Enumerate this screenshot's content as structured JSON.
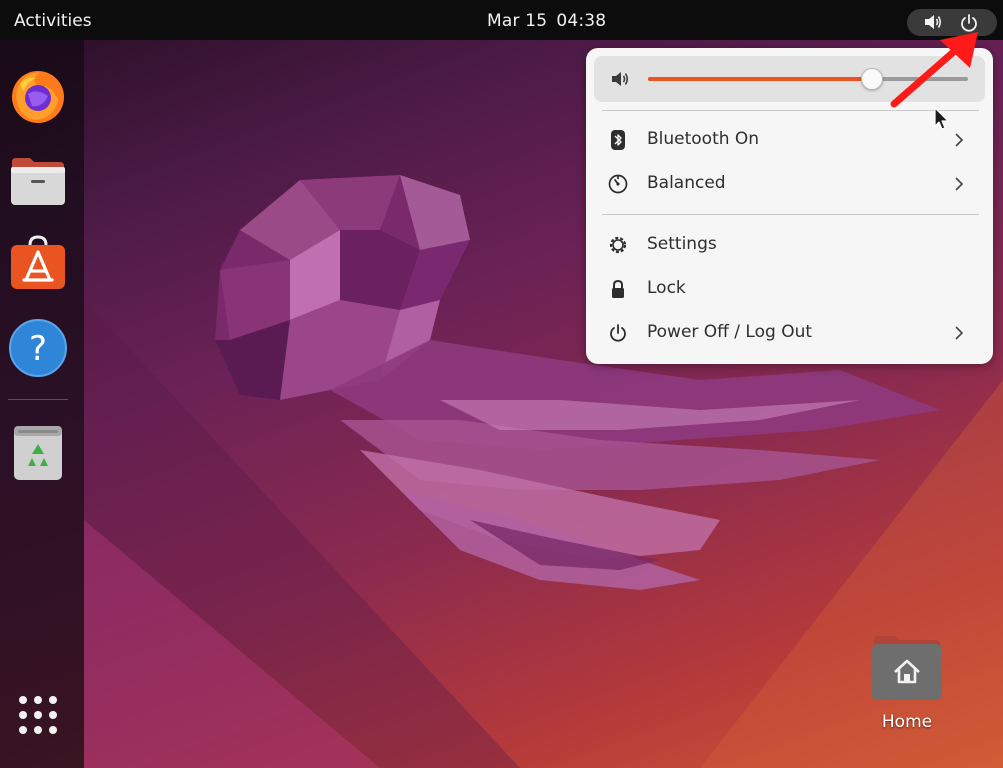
{
  "topbar": {
    "activities_label": "Activities",
    "date": "Mar 15",
    "time": "04:38",
    "status_icons": [
      "speaker-icon",
      "power-icon"
    ]
  },
  "dock": {
    "items": [
      {
        "name": "firefox",
        "icon": "firefox-icon"
      },
      {
        "name": "files",
        "icon": "files-icon"
      },
      {
        "name": "app-center",
        "icon": "app-store-icon"
      },
      {
        "name": "help",
        "icon": "help-icon"
      },
      {
        "name": "trash",
        "icon": "trash-icon"
      }
    ],
    "apps_button_icon": "apps-grid-icon"
  },
  "desktop": {
    "home_label": "Home"
  },
  "quick_settings": {
    "volume_level": 0.7,
    "accent_color": "#e9541f",
    "items": [
      {
        "label": "Bluetooth On",
        "icon": "bluetooth-icon",
        "has_submenu": true
      },
      {
        "label": "Balanced",
        "icon": "power-profile-icon",
        "has_submenu": true
      },
      {
        "label": "Settings",
        "icon": "gear-icon",
        "has_submenu": false
      },
      {
        "label": "Lock",
        "icon": "lock-icon",
        "has_submenu": false
      },
      {
        "label": "Power Off / Log Out",
        "icon": "power-icon",
        "has_submenu": true
      }
    ]
  },
  "annotation": {
    "arrow_color": "#ff1a1a"
  }
}
